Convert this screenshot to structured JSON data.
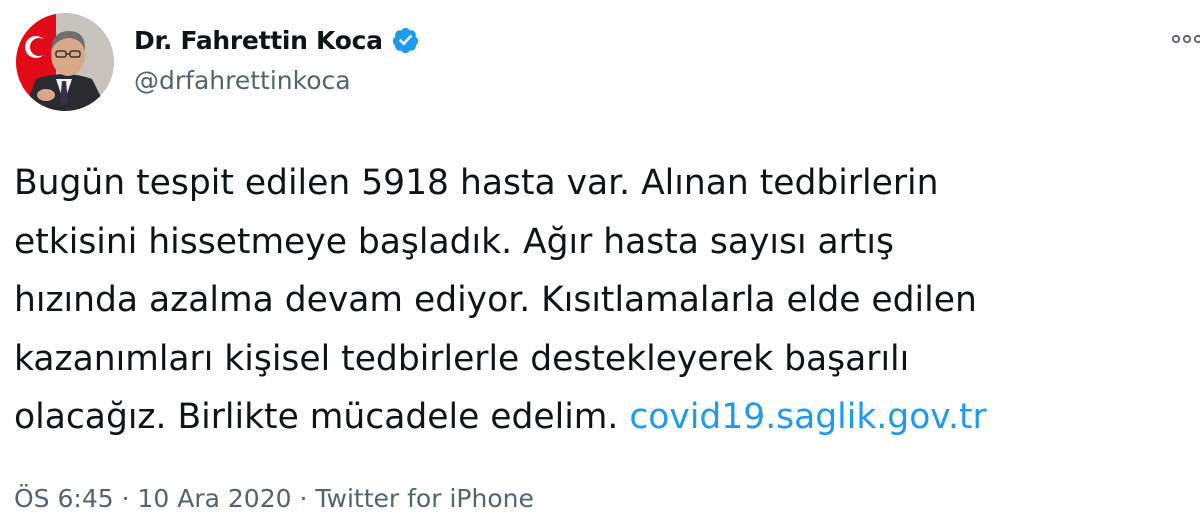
{
  "author": {
    "display_name": "Dr. Fahrettin Koca",
    "handle": "@drfahrettinkoca",
    "verified": true
  },
  "tweet": {
    "lines": [
      "Bugün tespit edilen 5918 hasta var. Alınan tedbirlerin",
      "etkisini hissetmeye başladık. Ağır hasta sayısı artış",
      "hızında azalma devam ediyor. Kısıtlamalarla elde edilen",
      "kazanımları kişisel tedbirlerle destekleyerek başarılı",
      "olacağız. Birlikte mücadele edelim."
    ],
    "link_text": "covid19.saglik.gov.tr"
  },
  "meta": {
    "time": "ÖS 6:45",
    "separator": "·",
    "date": "10 Ara 2020",
    "source": "Twitter for iPhone"
  },
  "colors": {
    "link": "#1d9bf0",
    "verified_badge": "#1d9bf0",
    "secondary_text": "#536471",
    "avatar_flag_red": "#e30a17"
  },
  "icons": {
    "verified": "verified-badge-icon",
    "more": "more-options-icon"
  }
}
